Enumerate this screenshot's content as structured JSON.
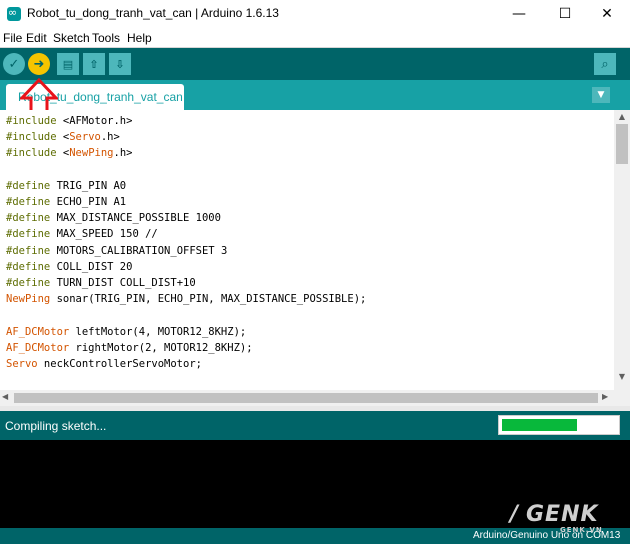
{
  "window": {
    "title": "Robot_tu_dong_tranh_vat_can | Arduino 1.6.13",
    "controls": {
      "minimize": "—",
      "maximize": "☐",
      "close": "✕"
    }
  },
  "menu": {
    "items": [
      "File",
      "Edit",
      "Sketch",
      "Tools",
      "Help"
    ]
  },
  "toolbar": {
    "verify_glyph": "✓",
    "upload_glyph": "➜",
    "new_glyph": "▤",
    "open_glyph": "⇧",
    "save_glyph": "⇩",
    "serial_glyph": "⌕",
    "icons": [
      "check-icon",
      "arrow-right-icon",
      "new-file-icon",
      "open-up-arrow-icon",
      "save-down-arrow-icon",
      "magnifier-icon"
    ]
  },
  "tabs": {
    "active_label": "Robot_tu_dong_tranh_vat_can",
    "menu_glyph": "▼"
  },
  "editor": {
    "lines": [
      [
        {
          "t": "#include",
          "c": "kw-pp"
        },
        {
          "t": " <AFMotor.h>",
          "c": "tx"
        }
      ],
      [
        {
          "t": "#include",
          "c": "kw-pp"
        },
        {
          "t": " <",
          "c": "tx"
        },
        {
          "t": "Servo",
          "c": "kw-type"
        },
        {
          "t": ".h>",
          "c": "tx"
        }
      ],
      [
        {
          "t": "#include",
          "c": "kw-pp"
        },
        {
          "t": " <",
          "c": "tx"
        },
        {
          "t": "NewPing",
          "c": "kw-type"
        },
        {
          "t": ".h>",
          "c": "tx"
        }
      ],
      [],
      [
        {
          "t": "#define",
          "c": "kw-pp"
        },
        {
          "t": " TRIG_PIN A0",
          "c": "tx"
        }
      ],
      [
        {
          "t": "#define",
          "c": "kw-pp"
        },
        {
          "t": " ECHO_PIN A1",
          "c": "tx"
        }
      ],
      [
        {
          "t": "#define",
          "c": "kw-pp"
        },
        {
          "t": " MAX_DISTANCE_POSSIBLE 1000",
          "c": "tx"
        }
      ],
      [
        {
          "t": "#define",
          "c": "kw-pp"
        },
        {
          "t": " MAX_SPEED 150 //",
          "c": "tx"
        }
      ],
      [
        {
          "t": "#define",
          "c": "kw-pp"
        },
        {
          "t": " MOTORS_CALIBRATION_OFFSET 3",
          "c": "tx"
        }
      ],
      [
        {
          "t": "#define",
          "c": "kw-pp"
        },
        {
          "t": " COLL_DIST 20",
          "c": "tx"
        }
      ],
      [
        {
          "t": "#define",
          "c": "kw-pp"
        },
        {
          "t": " TURN_DIST COLL_DIST+10",
          "c": "tx"
        }
      ],
      [
        {
          "t": "NewPing",
          "c": "kw-type"
        },
        {
          "t": " sonar(TRIG_PIN, ECHO_PIN, MAX_DISTANCE_POSSIBLE);",
          "c": "tx"
        }
      ],
      [],
      [
        {
          "t": "AF_DCMotor",
          "c": "kw-type"
        },
        {
          "t": " leftMotor(4, MOTOR12_8KHZ);",
          "c": "tx"
        }
      ],
      [
        {
          "t": "AF_DCMotor",
          "c": "kw-type"
        },
        {
          "t": " rightMotor(2, MOTOR12_8KHZ);",
          "c": "tx"
        }
      ],
      [
        {
          "t": "Servo",
          "c": "kw-type"
        },
        {
          "t": " neckControllerServoMotor;",
          "c": "tx"
        }
      ]
    ]
  },
  "status": {
    "message": "Compiling sketch...",
    "progress": 0.66
  },
  "footer": {
    "board_port": "Arduino/Genuino Uno on COM13"
  },
  "watermark": {
    "brand": "GENK",
    "sub": "GENK.VN"
  },
  "colors": {
    "teal_dark": "#006468",
    "teal_mid": "#17a1a5",
    "upload_yellow": "#f5c400",
    "progress_green": "#08b83b",
    "annotation_red": "#e8131a"
  }
}
